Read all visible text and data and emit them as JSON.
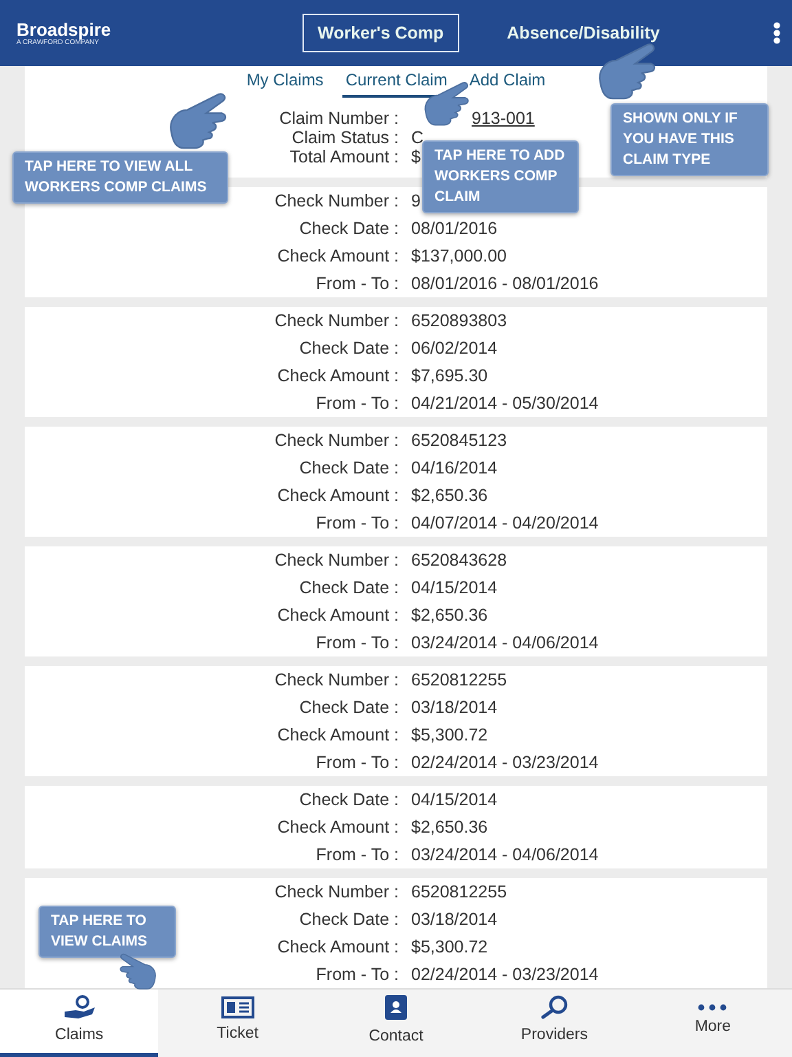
{
  "header": {
    "logo": "Broadspire",
    "logo_tagline": "A CRAWFORD COMPANY",
    "segments": [
      {
        "label": "Worker's Comp",
        "selected": true
      },
      {
        "label": "Absence/Disability",
        "selected": false
      }
    ]
  },
  "subtabs": [
    {
      "label": "My Claims",
      "selected": false
    },
    {
      "label": "Current Claim",
      "selected": true
    },
    {
      "label": "Add Claim",
      "selected": false
    }
  ],
  "claim_info": [
    {
      "label": "Claim Number :",
      "value": "913-001",
      "kind": "link"
    },
    {
      "label": "Claim Status :",
      "value": "C",
      "kind": "text"
    },
    {
      "label": "Total Amount :",
      "value": "$",
      "kind": "text"
    }
  ],
  "checks": [
    {
      "fields": [
        {
          "label": "Check Number :",
          "value": "9"
        },
        {
          "label": "Check Date :",
          "value": "08/01/2016"
        },
        {
          "label": "Check Amount :",
          "value": "$137,000.00"
        },
        {
          "label": "From - To :",
          "value": "08/01/2016 - 08/01/2016"
        }
      ]
    },
    {
      "fields": [
        {
          "label": "Check Number :",
          "value": "6520893803"
        },
        {
          "label": "Check Date :",
          "value": "06/02/2014"
        },
        {
          "label": "Check Amount :",
          "value": "$7,695.30"
        },
        {
          "label": "From - To :",
          "value": "04/21/2014 - 05/30/2014"
        }
      ]
    },
    {
      "fields": [
        {
          "label": "Check Number :",
          "value": "6520845123"
        },
        {
          "label": "Check Date :",
          "value": "04/16/2014"
        },
        {
          "label": "Check Amount :",
          "value": "$2,650.36"
        },
        {
          "label": "From - To :",
          "value": "04/07/2014 - 04/20/2014"
        }
      ]
    },
    {
      "fields": [
        {
          "label": "Check Number :",
          "value": "6520843628"
        },
        {
          "label": "Check Date :",
          "value": "04/15/2014"
        },
        {
          "label": "Check Amount :",
          "value": "$2,650.36"
        },
        {
          "label": "From - To :",
          "value": "03/24/2014 - 04/06/2014"
        }
      ]
    },
    {
      "fields": [
        {
          "label": "Check Number :",
          "value": "6520812255"
        },
        {
          "label": "Check Date :",
          "value": "03/18/2014"
        },
        {
          "label": "Check Amount :",
          "value": "$5,300.72"
        },
        {
          "label": "From - To :",
          "value": "02/24/2014 - 03/23/2014"
        }
      ]
    },
    {
      "fields": [
        {
          "label": "Check Date :",
          "value": "04/15/2014"
        },
        {
          "label": "Check Amount :",
          "value": "$2,650.36"
        },
        {
          "label": "From - To :",
          "value": "03/24/2014 - 04/06/2014"
        }
      ]
    },
    {
      "fields": [
        {
          "label": "Check Number :",
          "value": "6520812255"
        },
        {
          "label": "Check Date :",
          "value": "03/18/2014"
        },
        {
          "label": "Check Amount :",
          "value": "$5,300.72"
        },
        {
          "label": "From - To :",
          "value": "02/24/2014 - 03/23/2014"
        }
      ]
    }
  ],
  "callouts": [
    "TAP HERE TO VIEW ALL WORKERS COMP CLAIMS",
    "TAP HERE TO ADD WORKERS COMP CLAIM",
    "SHOWN ONLY IF YOU HAVE THIS CLAIM TYPE",
    "TAP HERE TO VIEW CLAIMS"
  ],
  "bottom_nav": [
    {
      "label": "Claims",
      "selected": true,
      "kind": "claims"
    },
    {
      "label": "Ticket",
      "selected": false,
      "kind": "ticket"
    },
    {
      "label": "Contact",
      "selected": false,
      "kind": "contact"
    },
    {
      "label": "Providers",
      "selected": false,
      "kind": "providers"
    },
    {
      "label": "More",
      "selected": false,
      "kind": "more"
    }
  ]
}
